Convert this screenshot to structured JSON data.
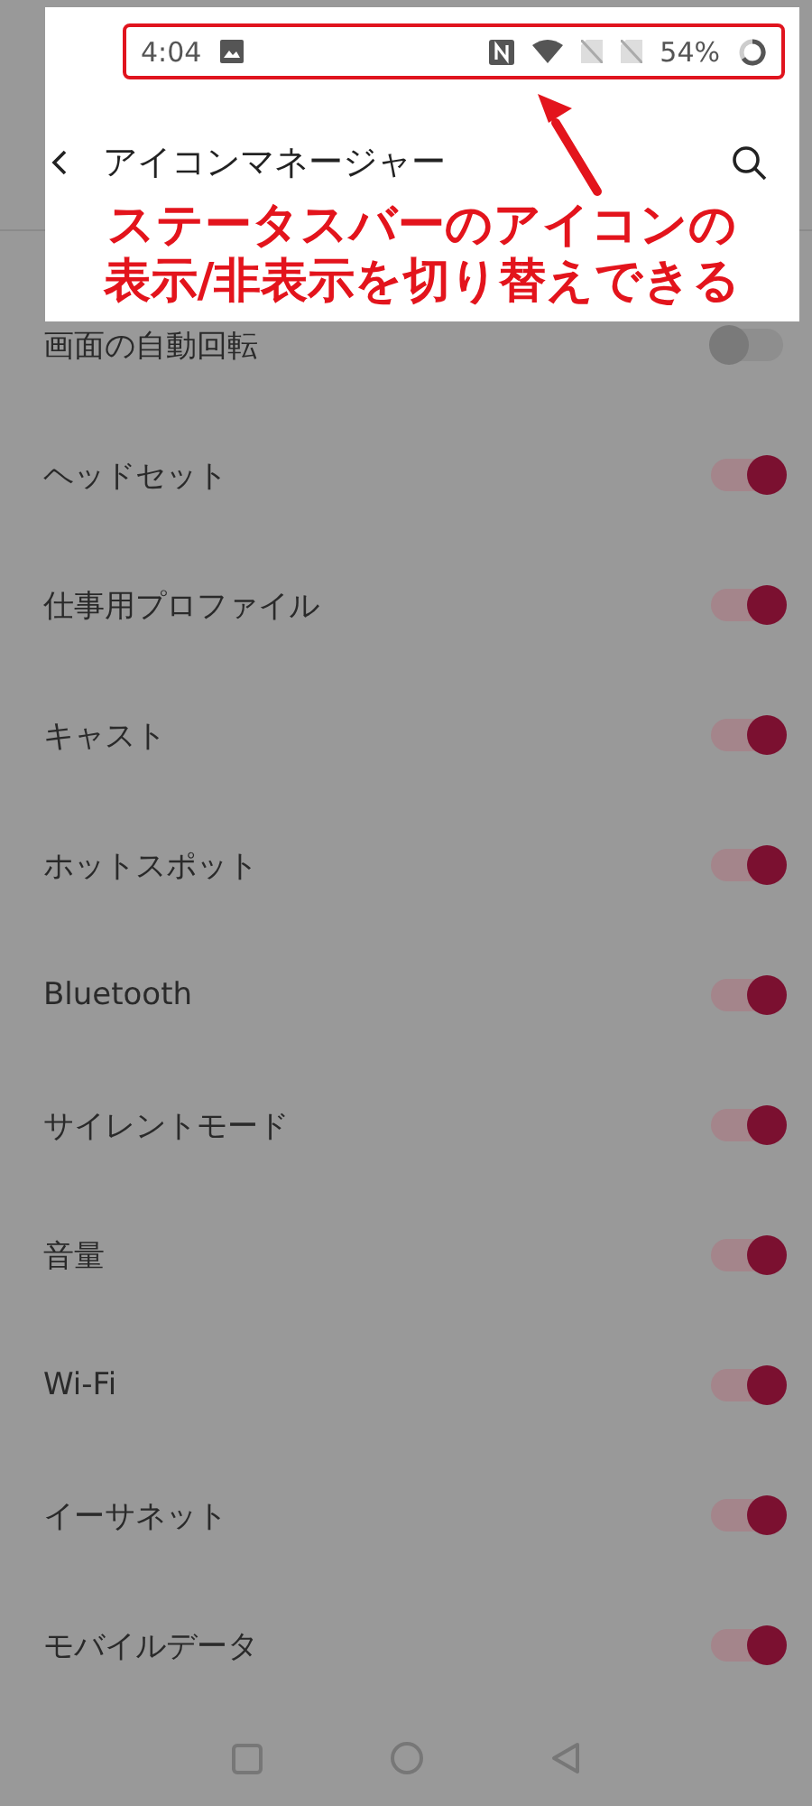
{
  "status_bar": {
    "time": "4:04",
    "battery": "54%"
  },
  "header": {
    "title": "アイコンマネージャー"
  },
  "annotation": {
    "lines": [
      "ステータスバーのアイコンの",
      "表示/非表示を切り替えできる"
    ]
  },
  "items": [
    {
      "label": "画面の自動回転",
      "on": false
    },
    {
      "label": "ヘッドセット",
      "on": true
    },
    {
      "label": "仕事用プロファイル",
      "on": true
    },
    {
      "label": "キャスト",
      "on": true
    },
    {
      "label": "ホットスポット",
      "on": true
    },
    {
      "label": "Bluetooth",
      "on": true
    },
    {
      "label": "サイレントモード",
      "on": true
    },
    {
      "label": "音量",
      "on": true
    },
    {
      "label": "Wi-Fi",
      "on": true
    },
    {
      "label": "イーサネット",
      "on": true
    },
    {
      "label": "モバイルデータ",
      "on": true
    }
  ]
}
